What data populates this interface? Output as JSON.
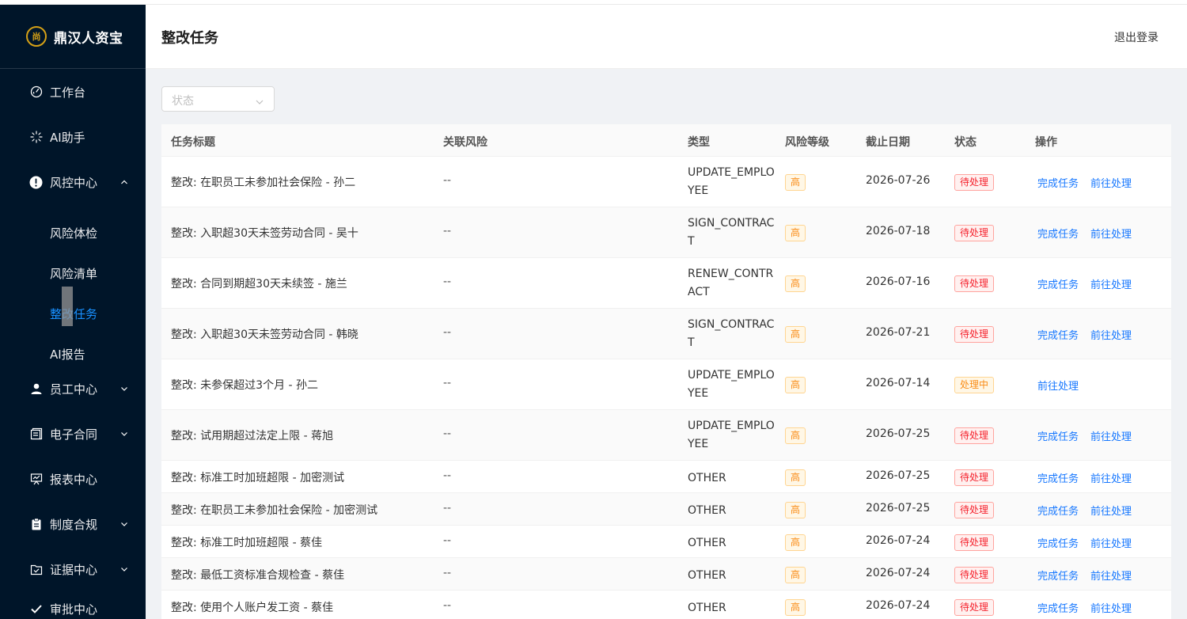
{
  "brand": {
    "name": "鼎汉人资宝",
    "logo_mark": "尚"
  },
  "sidebar": {
    "items": [
      {
        "label": "工作台",
        "icon": "dashboard-icon"
      },
      {
        "label": "AI助手",
        "icon": "sparkle-icon"
      },
      {
        "label": "风控中心",
        "icon": "alert-circle-icon",
        "expanded": true,
        "children": [
          {
            "label": "风险体检"
          },
          {
            "label": "风险清单"
          },
          {
            "label": "整改任务",
            "active": true
          },
          {
            "label": "AI报告"
          }
        ]
      },
      {
        "label": "员工中心",
        "icon": "user-icon",
        "expanded": false
      },
      {
        "label": "电子合同",
        "icon": "contract-icon",
        "expanded": false
      },
      {
        "label": "报表中心",
        "icon": "presentation-icon"
      },
      {
        "label": "制度合规",
        "icon": "clipboard-icon",
        "expanded": false
      },
      {
        "label": "证据中心",
        "icon": "evidence-icon",
        "expanded": false
      },
      {
        "label": "审批中心",
        "icon": "check-icon"
      }
    ]
  },
  "header": {
    "title": "整改任务",
    "logout_label": "退出登录"
  },
  "filter": {
    "status_placeholder": "状态"
  },
  "table": {
    "columns": [
      "任务标题",
      "关联风险",
      "类型",
      "风险等级",
      "截止日期",
      "状态",
      "操作"
    ],
    "rows": [
      {
        "title": "整改: 在职员工未参加社会保险 - 孙二",
        "risk": "--",
        "type": "UPDATE_EMPLOYEE",
        "level": "高",
        "due": "2026-07-26",
        "status": "待处理",
        "actions": [
          "完成任务",
          "前往处理"
        ]
      },
      {
        "title": "整改: 入职超30天未签劳动合同 - 吴十",
        "risk": "--",
        "type": "SIGN_CONTRACT",
        "level": "高",
        "due": "2026-07-18",
        "status": "待处理",
        "actions": [
          "完成任务",
          "前往处理"
        ]
      },
      {
        "title": "整改: 合同到期超30天未续签 - 施兰",
        "risk": "--",
        "type": "RENEW_CONTRACT",
        "level": "高",
        "due": "2026-07-16",
        "status": "待处理",
        "actions": [
          "完成任务",
          "前往处理"
        ]
      },
      {
        "title": "整改: 入职超30天未签劳动合同 - 韩晓",
        "risk": "--",
        "type": "SIGN_CONTRACT",
        "level": "高",
        "due": "2026-07-21",
        "status": "待处理",
        "actions": [
          "完成任务",
          "前往处理"
        ]
      },
      {
        "title": "整改: 未参保超过3个月 - 孙二",
        "risk": "--",
        "type": "UPDATE_EMPLOYEE",
        "level": "高",
        "due": "2026-07-14",
        "status": "处理中",
        "actions": [
          "前往处理"
        ]
      },
      {
        "title": "整改: 试用期超过法定上限 - 蒋旭",
        "risk": "--",
        "type": "UPDATE_EMPLOYEE",
        "level": "高",
        "due": "2026-07-25",
        "status": "待处理",
        "actions": [
          "完成任务",
          "前往处理"
        ]
      },
      {
        "title": "整改: 标准工时加班超限 - 加密测试",
        "risk": "--",
        "type": "OTHER",
        "level": "高",
        "due": "2026-07-25",
        "status": "待处理",
        "actions": [
          "完成任务",
          "前往处理"
        ]
      },
      {
        "title": "整改: 在职员工未参加社会保险 - 加密测试",
        "risk": "--",
        "type": "OTHER",
        "level": "高",
        "due": "2026-07-25",
        "status": "待处理",
        "actions": [
          "完成任务",
          "前往处理"
        ]
      },
      {
        "title": "整改: 标准工时加班超限 - 蔡佳",
        "risk": "--",
        "type": "OTHER",
        "level": "高",
        "due": "2026-07-24",
        "status": "待处理",
        "actions": [
          "完成任务",
          "前往处理"
        ]
      },
      {
        "title": "整改: 最低工资标准合规检查 - 蔡佳",
        "risk": "--",
        "type": "OTHER",
        "level": "高",
        "due": "2026-07-24",
        "status": "待处理",
        "actions": [
          "完成任务",
          "前往处理"
        ]
      },
      {
        "title": "整改: 使用个人账户发工资 - 蔡佳",
        "risk": "--",
        "type": "OTHER",
        "level": "高",
        "due": "2026-07-24",
        "status": "待处理",
        "actions": [
          "完成任务",
          "前往处理"
        ]
      }
    ]
  },
  "colors": {
    "sidebar_bg": "#001529",
    "accent": "#1677ff",
    "danger": "#f5222d",
    "warning": "#fa8c16",
    "brand_gold": "#d4a017"
  }
}
